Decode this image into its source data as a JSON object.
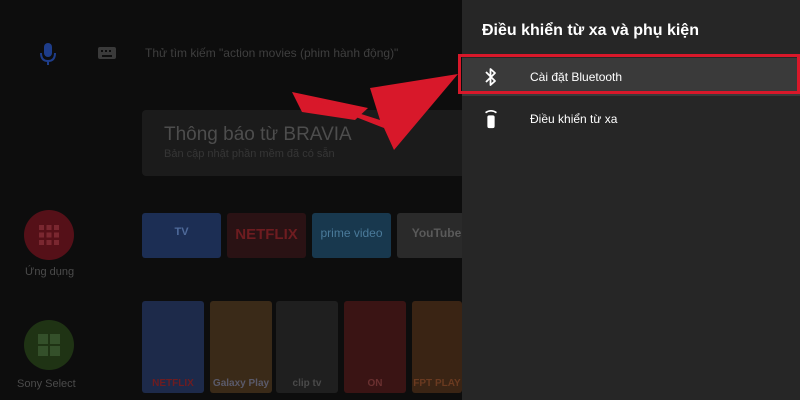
{
  "home": {
    "search_placeholder": "Thử tìm kiếm \"action movies (phim hành động)\"",
    "notification": {
      "title": "Thông báo từ BRAVIA",
      "subtitle": "Bản cập nhật phần mềm đã có sẵn"
    },
    "apps_label": "Ứng dụng",
    "sony_select_label": "Sony Select",
    "app_tiles": [
      {
        "label": "TV",
        "color": "#1c2e54"
      },
      {
        "label": "NETFLIX",
        "color": "#2a1214"
      },
      {
        "label": "prime video",
        "color": "#18384e"
      },
      {
        "label": "YouTube",
        "color": "#2a2a2a"
      }
    ],
    "content_cards": [
      {
        "label": "NETFLIX",
        "color": "#1d2a4a"
      },
      {
        "label": "Galaxy Play",
        "color": "#3a2a18"
      },
      {
        "label": "clip tv",
        "color": "#1f1f1f"
      },
      {
        "label": "ON",
        "color": "#3a1414"
      },
      {
        "label": "FPT PLAY",
        "color": "#3a2414"
      }
    ]
  },
  "panel": {
    "title": "Điều khiển từ xa và phụ kiện",
    "items": [
      {
        "label": "Cài đặt Bluetooth",
        "icon": "bluetooth-icon"
      },
      {
        "label": "Điều khiển từ xa",
        "icon": "remote-icon"
      }
    ]
  },
  "colors": {
    "panel_bg": "#262626",
    "highlight": "#d8182a",
    "arrow": "#d8182a"
  }
}
